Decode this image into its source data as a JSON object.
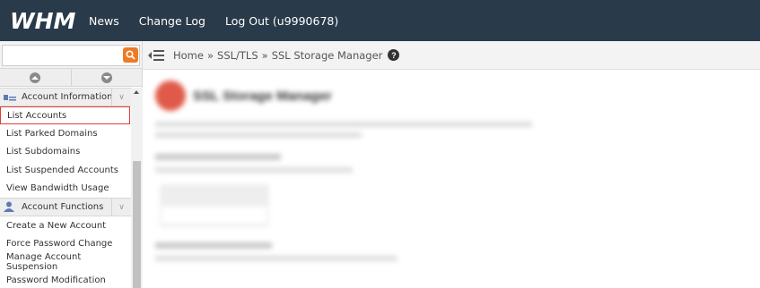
{
  "app": {
    "logo_text": "WHM"
  },
  "topnav": [
    {
      "label": "News"
    },
    {
      "label": "Change Log"
    },
    {
      "label": "Log Out (u9990678)"
    }
  ],
  "search": {
    "value": "",
    "placeholder": ""
  },
  "breadcrumb": {
    "home": "Home",
    "section": "SSL/TLS",
    "current": "SSL Storage Manager",
    "separator": "»"
  },
  "sidebar": {
    "categories": [
      {
        "label": "Account Information",
        "items": [
          {
            "label": "List Accounts",
            "selected": true
          },
          {
            "label": "List Parked Domains"
          },
          {
            "label": "List Subdomains"
          },
          {
            "label": "List Suspended Accounts"
          },
          {
            "label": "View Bandwidth Usage"
          }
        ]
      },
      {
        "label": "Account Functions",
        "items": [
          {
            "label": "Create a New Account"
          },
          {
            "label": "Force Password Change"
          },
          {
            "label": "Manage Account Suspension"
          },
          {
            "label": "Password Modification"
          }
        ]
      }
    ]
  },
  "colors": {
    "topbar": "#293a4a",
    "accent": "#ee7a24",
    "selected_border": "#e23b3b"
  }
}
